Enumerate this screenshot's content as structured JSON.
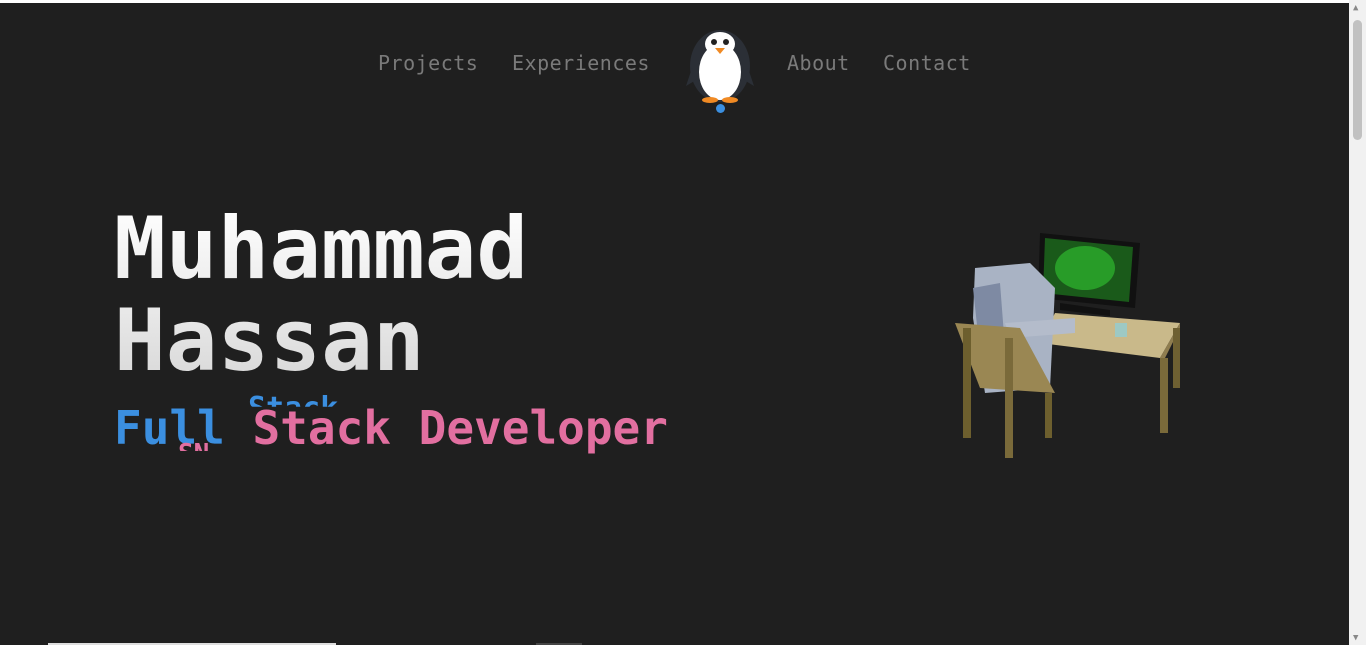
{
  "nav": {
    "items": [
      {
        "label": "Projects"
      },
      {
        "label": "Experiences"
      },
      {
        "label": "About"
      },
      {
        "label": "Contact"
      }
    ],
    "logo": "penguin-logo"
  },
  "hero": {
    "name_line1": "Muhammad",
    "name_line2": "Hassan",
    "role_first": "Full",
    "role_second": "Stack",
    "role_third": "Developer",
    "glitch_top": "Stack",
    "glitch_bottom": "SN"
  },
  "colors": {
    "background": "#1f1f1f",
    "accent_blue": "#3b8fe0",
    "accent_pink": "#e26fa0"
  }
}
